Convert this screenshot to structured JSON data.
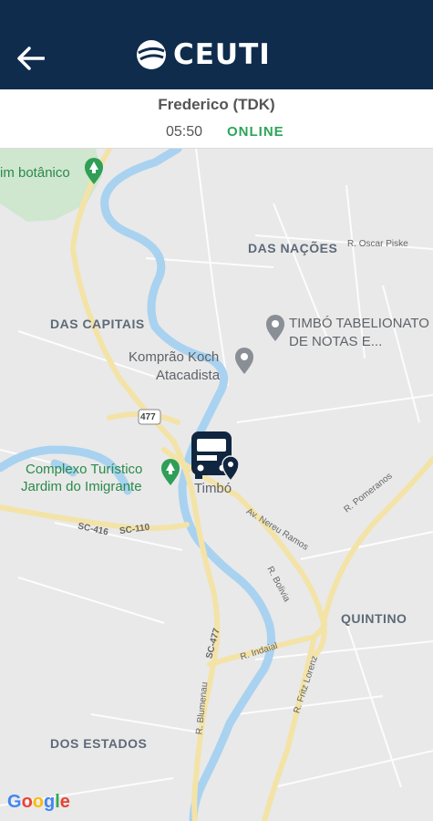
{
  "header": {
    "back_icon": "arrow-left-icon",
    "logo_text": "CEUTI",
    "background": "#0f2c4d"
  },
  "trip": {
    "driver": "Frederico (TDK)",
    "time": "05:50",
    "status": "ONLINE",
    "status_color": "#2ca55a"
  },
  "map": {
    "areas": [
      "DAS NAÇÕES",
      "DAS CAPITAIS",
      "QUINTINO",
      "DOS ESTADOS"
    ],
    "places": [
      {
        "label": "im botânico",
        "icon": "tree-pin-icon"
      },
      {
        "label": "TIMBÓ TABELIONATO",
        "label2": "DE NOTAS E...",
        "icon": "place-pin-icon"
      },
      {
        "label": "Komprão Koch",
        "label2": "Atacadista",
        "icon": "place-pin-icon"
      },
      {
        "label": "Complexo Turístico",
        "label2": "Jardim do Imigrante",
        "icon": "tree-pin-icon"
      }
    ],
    "city": "Timbó",
    "streets": [
      "R. Oscar Piske",
      "R. Pomeranos",
      "Av. Nereu Ramos",
      "R. Bolivia",
      "R. Indaial",
      "R. Fritz Lorenz",
      "R. Blumenau",
      "SC-477",
      "SC-416",
      "SC-110"
    ],
    "route_shield": "477",
    "vehicle_icon": "bus-location-icon",
    "attribution": "Google"
  }
}
